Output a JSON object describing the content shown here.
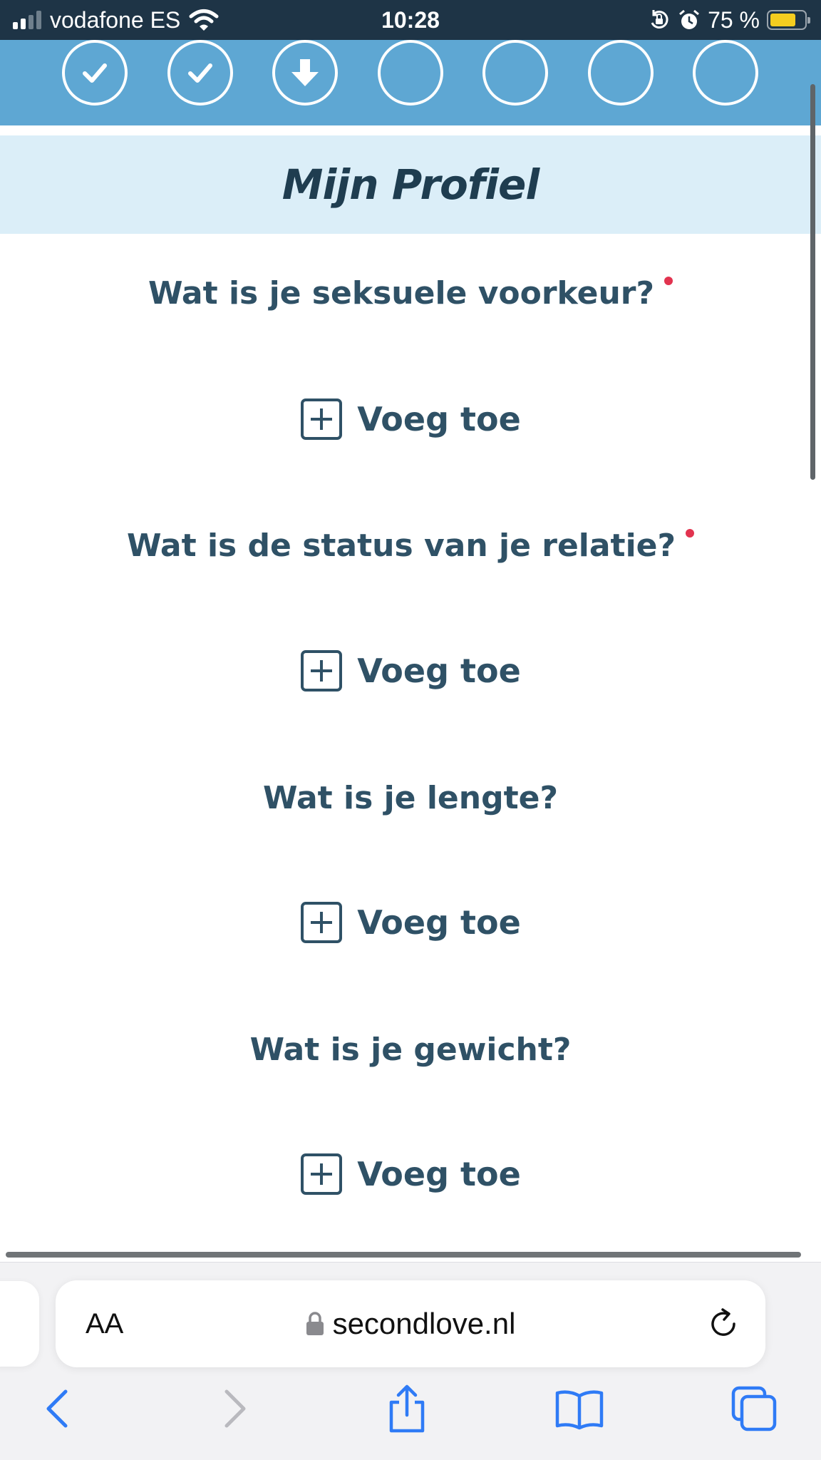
{
  "status_bar": {
    "carrier": "vodafone ES",
    "time": "10:28",
    "battery_percent_label": "75 %",
    "battery_level": 0.75,
    "icons": [
      "signal-icon",
      "wifi-icon",
      "orientation-lock-icon",
      "alarm-icon",
      "battery-icon"
    ]
  },
  "progress": {
    "steps": [
      {
        "state": "completed",
        "icon": "check-icon"
      },
      {
        "state": "completed",
        "icon": "check-icon"
      },
      {
        "state": "current",
        "icon": "arrow-down-icon"
      },
      {
        "state": "pending",
        "icon": ""
      },
      {
        "state": "pending",
        "icon": ""
      },
      {
        "state": "pending",
        "icon": ""
      },
      {
        "state": "pending",
        "icon": ""
      }
    ]
  },
  "section": {
    "title": "Mijn Profiel"
  },
  "questions": [
    {
      "label": "Wat is je seksuele voorkeur?",
      "required": true,
      "action_label": "Voeg toe"
    },
    {
      "label": "Wat is de status van je relatie?",
      "required": true,
      "action_label": "Voeg toe"
    },
    {
      "label": "Wat is je lengte?",
      "required": false,
      "action_label": "Voeg toe"
    },
    {
      "label": "Wat is je gewicht?",
      "required": false,
      "action_label": "Voeg toe"
    }
  ],
  "browser": {
    "text_size_label": "AA",
    "url": "secondlove.nl",
    "toolbar": [
      "back-icon",
      "forward-icon",
      "share-icon",
      "bookmarks-icon",
      "tabs-icon"
    ]
  },
  "colors": {
    "status_bar_bg": "#1e3446",
    "progress_bg": "#5ea7d3",
    "section_bg": "#dbeef8",
    "text": "#2f5166",
    "required_dot": "#e2334f",
    "ios_blue": "#2f7bf6"
  }
}
